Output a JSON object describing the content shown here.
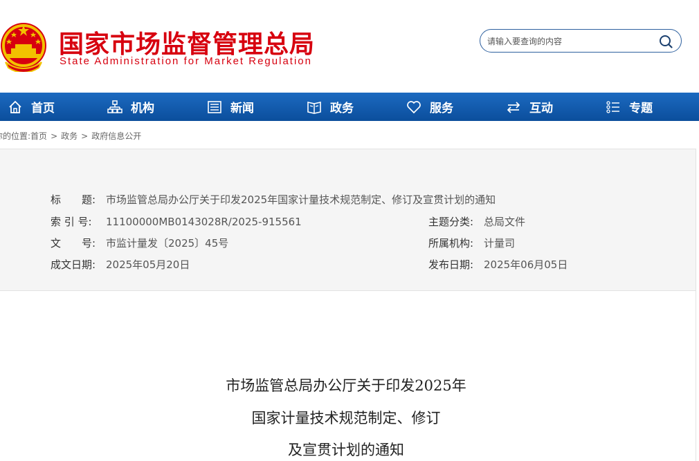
{
  "header": {
    "title_cn": "国家市场监督管理总局",
    "title_en": "State Administration for Market Regulation",
    "emblem_icon": "national-emblem-icon",
    "brand_color": "#d7000f"
  },
  "search": {
    "placeholder": "请输入要查询的内容",
    "icon": "search-icon"
  },
  "nav": {
    "color": "#0d56a8",
    "items": [
      {
        "label": "首页",
        "icon": "home-icon"
      },
      {
        "label": "机构",
        "icon": "org-chart-icon"
      },
      {
        "label": "新闻",
        "icon": "news-icon"
      },
      {
        "label": "政务",
        "icon": "book-icon"
      },
      {
        "label": "服务",
        "icon": "heart-icon"
      },
      {
        "label": "互动",
        "icon": "exchange-icon"
      },
      {
        "label": "专题",
        "icon": "list-icon"
      }
    ]
  },
  "breadcrumb": {
    "prefix": "你的位置:",
    "items": [
      "首页",
      "政务",
      "政府信息公开"
    ],
    "separator": ">"
  },
  "info": {
    "title_label": "标　　题:",
    "title_value": "市场监管总局办公厅关于印发2025年国家计量技术规范制定、修订及宣贯计划的通知",
    "index_label": "索 引 号:",
    "index_value": "11100000MB0143028R/2025-915561",
    "topic_label": "主题分类:",
    "topic_value": "总局文件",
    "docno_label": "文　　号:",
    "docno_value": "市监计量发〔2025〕45号",
    "dept_label": "所属机构:",
    "dept_value": "计量司",
    "written_label": "成文日期:",
    "written_value": "2025年05月20日",
    "published_label": "发布日期:",
    "published_value": "2025年06月05日"
  },
  "document": {
    "title_lines": [
      "市场监管总局办公厅关于印发2025年",
      "国家计量技术规范制定、修订",
      "及宣贯计划的通知"
    ]
  }
}
